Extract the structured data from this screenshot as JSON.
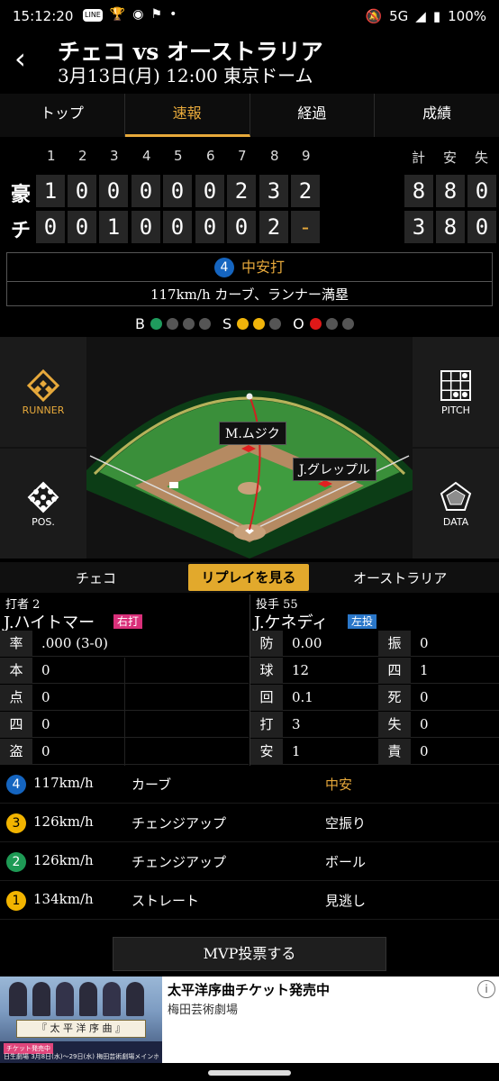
{
  "status_bar": {
    "time": "15:12:20",
    "notif_icons": [
      "LINE",
      "trophy-icon",
      "dot-icon",
      "flag-icon",
      "•"
    ],
    "network": "5G",
    "battery": "100%"
  },
  "header": {
    "title": "チェコ vs オーストラリア",
    "subtitle": "3月13日(月) 12:00 東京ドーム",
    "back_icon": "chevron-left-icon"
  },
  "tabs": [
    {
      "label": "トップ",
      "active": false
    },
    {
      "label": "速報",
      "active": true
    },
    {
      "label": "経過",
      "active": false
    },
    {
      "label": "成績",
      "active": false
    }
  ],
  "scoreboard": {
    "innings": [
      "1",
      "2",
      "3",
      "4",
      "5",
      "6",
      "7",
      "8",
      "9"
    ],
    "totals_header": [
      "計",
      "安",
      "失"
    ],
    "rows": [
      {
        "team": "豪",
        "scores": [
          "1",
          "0",
          "0",
          "0",
          "0",
          "0",
          "2",
          "3",
          "2"
        ],
        "totals": [
          "8",
          "8",
          "0"
        ]
      },
      {
        "team": "チ",
        "scores": [
          "0",
          "0",
          "1",
          "0",
          "0",
          "0",
          "0",
          "2",
          "-"
        ],
        "totals": [
          "3",
          "8",
          "0"
        ]
      }
    ]
  },
  "current_play": {
    "pitch_number": "4",
    "result": "中安打",
    "detail": "117km/h カーブ、ランナー満塁"
  },
  "count": {
    "b_label": "B",
    "s_label": "S",
    "o_label": "O",
    "balls": 1,
    "strikes": 2,
    "outs": 1
  },
  "field": {
    "runner_label": "RUNNER",
    "pitch_label": "PITCH",
    "pos_label": "POS.",
    "data_label": "DATA",
    "fielder_1": "M.ムジク",
    "fielder_2": "J.グレップル"
  },
  "replay_bar": {
    "home": "チェコ",
    "replay_button": "リプレイを見る",
    "away": "オーストラリア"
  },
  "batter": {
    "role": "打者 2",
    "name": "J.ハイトマー",
    "tag": "右打",
    "stats": [
      {
        "k": "率",
        "v": ".000 (3-0)"
      },
      {
        "k": "本",
        "v": "0"
      },
      {
        "k": "点",
        "v": "0"
      },
      {
        "k": "四",
        "v": "0"
      },
      {
        "k": "盗",
        "v": "0"
      }
    ]
  },
  "pitcher": {
    "role": "投手 55",
    "name": "J.ケネディ",
    "tag": "左投",
    "stats_a": [
      {
        "k": "防",
        "v": "0.00"
      },
      {
        "k": "球",
        "v": "12"
      },
      {
        "k": "回",
        "v": "0.1"
      },
      {
        "k": "打",
        "v": "3"
      },
      {
        "k": "安",
        "v": "1"
      }
    ],
    "stats_b": [
      {
        "k": "振",
        "v": "0"
      },
      {
        "k": "四",
        "v": "1"
      },
      {
        "k": "死",
        "v": "0"
      },
      {
        "k": "失",
        "v": "0"
      },
      {
        "k": "責",
        "v": "0"
      }
    ]
  },
  "pitches": [
    {
      "num": "4",
      "speed": "117km/h",
      "type": "カーブ",
      "result": "中安",
      "color": "#1565c0",
      "highlight": true
    },
    {
      "num": "3",
      "speed": "126km/h",
      "type": "チェンジアップ",
      "result": "空振り",
      "color": "#f2b400",
      "highlight": false
    },
    {
      "num": "2",
      "speed": "126km/h",
      "type": "チェンジアップ",
      "result": "ボール",
      "color": "#1e9a55",
      "highlight": false
    },
    {
      "num": "1",
      "speed": "134km/h",
      "type": "ストレート",
      "result": "見逃し",
      "color": "#f2b400",
      "highlight": false
    }
  ],
  "mvp_button": "MVP投票する",
  "ad": {
    "title": "太平洋序曲チケット発売中",
    "subtitle": "梅田芸術劇場",
    "banner_text": "『 太 平 洋 序 曲 』",
    "tag": "チケット発売中",
    "small_text": "日生劇場 3月8日(水)〜29日(水) 梅田芸術劇場メインホール 4月8日(土)〜16日(日)",
    "info_icon": "info-icon"
  },
  "colors": {
    "accent": "#e7a93b",
    "highlight_result": "#e7a93b"
  }
}
